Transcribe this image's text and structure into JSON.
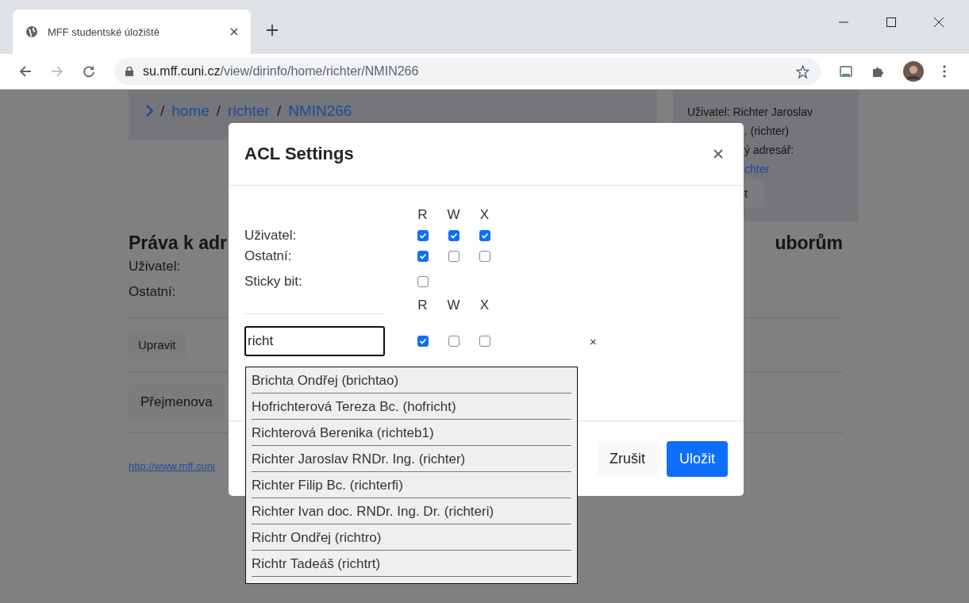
{
  "browser": {
    "tab_title": "MFF studentské úložiště",
    "url_host": "su.mff.cuni.cz",
    "url_path": "/view/dirinfo/home/richter/NMIN266"
  },
  "page": {
    "breadcrumb": [
      {
        "separator": "/",
        "label": "home",
        "kind": "link"
      },
      {
        "separator": "/",
        "label": "richter",
        "kind": "link"
      },
      {
        "separator": "/",
        "label": "NMIN266",
        "kind": "link"
      }
    ],
    "user_panel": {
      "user": "Uživatel: Richter Jaroslav",
      "fragments": [
        ". (richter)",
        "ý adresář:"
      ],
      "link": "chter",
      "button": "t"
    },
    "heading_left": "Práva k adr",
    "heading_right": "uborům",
    "labels": [
      "Uživatel:",
      "Ostatní:"
    ],
    "buttons": [
      "Upravit",
      "Přejmenova"
    ],
    "footer_link": "http://www.mff.cuni"
  },
  "modal": {
    "title": "ACL Settings",
    "columns": [
      "R",
      "W",
      "X"
    ],
    "rows": [
      {
        "label": "Uživatel:",
        "permissions": [
          {
            "checked": true
          },
          {
            "checked": true
          },
          {
            "checked": true
          }
        ]
      },
      {
        "label": "Ostatní:",
        "permissions": [
          {
            "checked": true
          },
          {
            "checked": false
          },
          {
            "checked": false
          }
        ]
      }
    ],
    "sticky": {
      "label": "Sticky bit:",
      "checked": false
    },
    "acl_columns": [
      "R",
      "W",
      "X"
    ],
    "entry": {
      "value": "richt",
      "permissions": [
        {
          "checked": true
        },
        {
          "checked": false
        },
        {
          "checked": false
        }
      ],
      "remove": "×"
    },
    "suggestions": [
      "Brichta Ondřej (brichtao)",
      "Hofrichterová Tereza Bc. (hofricht)",
      "Richterová Berenika (richteb1)",
      "Richter Jaroslav RNDr. Ing. (richter)",
      "Richter Filip Bc. (richterfi)",
      "Richter Ivan doc. RNDr. Ing. Dr. (richteri)",
      "Richtr Ondřej (richtro)",
      "Richtr Tadeáš (richtrt)"
    ],
    "buttons": [
      {
        "label": "Zrušit",
        "kind": "secondary"
      },
      {
        "label": "Uložit",
        "kind": "primary"
      }
    ]
  }
}
